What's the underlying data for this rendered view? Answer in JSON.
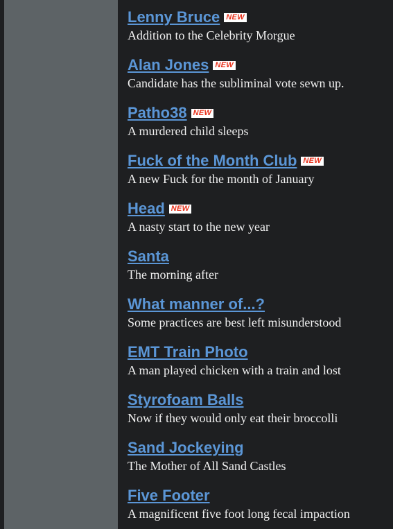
{
  "entries": [
    {
      "title": "Lenny Bruce",
      "desc": "Addition to the Celebrity Morgue",
      "badge": "NEW"
    },
    {
      "title": "Alan Jones",
      "desc": "Candidate has the subliminal vote sewn up.",
      "badge": "NEW"
    },
    {
      "title": "Patho38",
      "desc": "A murdered child sleeps",
      "badge": "NEW"
    },
    {
      "title": "Fuck of the Month Club",
      "desc": "A new Fuck for the month of January",
      "badge": "NEW"
    },
    {
      "title": "Head",
      "desc": "A nasty start to the new year",
      "badge": "NEW"
    },
    {
      "title": "Santa",
      "desc": "The morning after",
      "badge": ""
    },
    {
      "title": "What manner of...?",
      "desc": "Some practices are best left misunderstood",
      "badge": ""
    },
    {
      "title": "EMT Train Photo",
      "desc": "A man played chicken with a train and lost",
      "badge": ""
    },
    {
      "title": "Styrofoam Balls",
      "desc": "Now if they would only eat their broccolli",
      "badge": ""
    },
    {
      "title": "Sand Jockeying",
      "desc": "The Mother of All Sand Castles",
      "badge": ""
    },
    {
      "title": "Five Footer",
      "desc": "A magnificent five foot long fecal impaction",
      "badge": ""
    }
  ],
  "colors": {
    "link": "#5b96d6",
    "background": "#1e1f21",
    "sidebar": "#5d6366",
    "badge_text": "#e8321c",
    "badge_bg": "#ffffff",
    "description": "#f0f0f0"
  }
}
